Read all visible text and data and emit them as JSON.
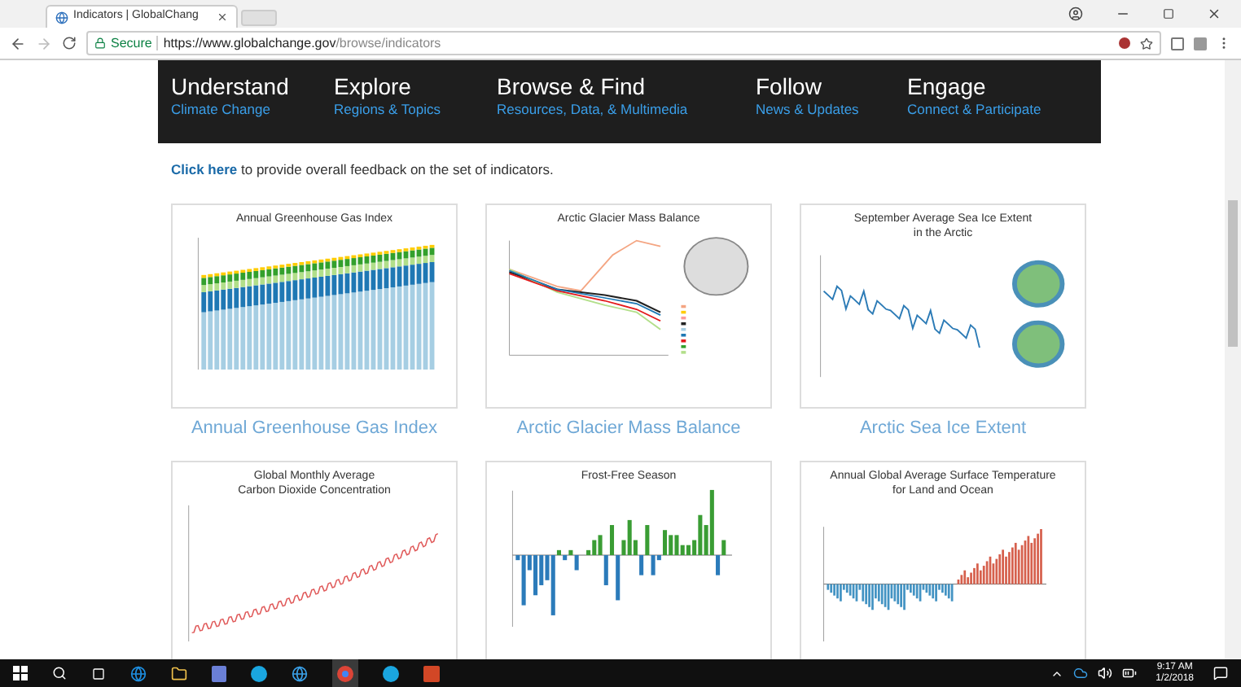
{
  "browser": {
    "tabs": [
      {
        "title": "Indicators | GlobalChang",
        "selected": true
      }
    ],
    "address": {
      "secure_label": "Secure",
      "url_host": "https://www.globalchange.gov",
      "url_path": "/browse/indicators"
    }
  },
  "page": {
    "nav": [
      {
        "title": "Understand",
        "subtitle": "Climate Change"
      },
      {
        "title": "Explore",
        "subtitle": "Regions & Topics"
      },
      {
        "title": "Browse & Find",
        "subtitle": "Resources, Data, & Multimedia"
      },
      {
        "title": "Follow",
        "subtitle": "News & Updates"
      },
      {
        "title": "Engage",
        "subtitle": "Connect & Participate"
      }
    ],
    "feedback": {
      "link": "Click here",
      "text": " to provide overall feedback on the set of indicators."
    },
    "indicators": [
      {
        "kind": "stacked",
        "chart_title": [
          "Annual Greenhouse Gas Index"
        ],
        "caption": "Annual Greenhouse Gas Index"
      },
      {
        "kind": "lines",
        "chart_title": [
          "Arctic Glacier Mass Balance"
        ],
        "caption": "Arctic Glacier Mass Balance"
      },
      {
        "kind": "series",
        "chart_title": [
          "September Average Sea Ice Extent",
          "in the Arctic"
        ],
        "caption": "Arctic Sea Ice Extent"
      },
      {
        "kind": "rising",
        "chart_title": [
          "Global Monthly Average",
          "Carbon Dioxide Concentration"
        ]
      },
      {
        "kind": "bars",
        "chart_title": [
          "Frost-Free Season"
        ]
      },
      {
        "kind": "anomaly",
        "chart_title": [
          "Annual Global Average Surface Temperature",
          "for Land and Ocean"
        ]
      }
    ]
  },
  "taskbar": {
    "time": "9:17 AM",
    "date": "1/2/2018"
  }
}
